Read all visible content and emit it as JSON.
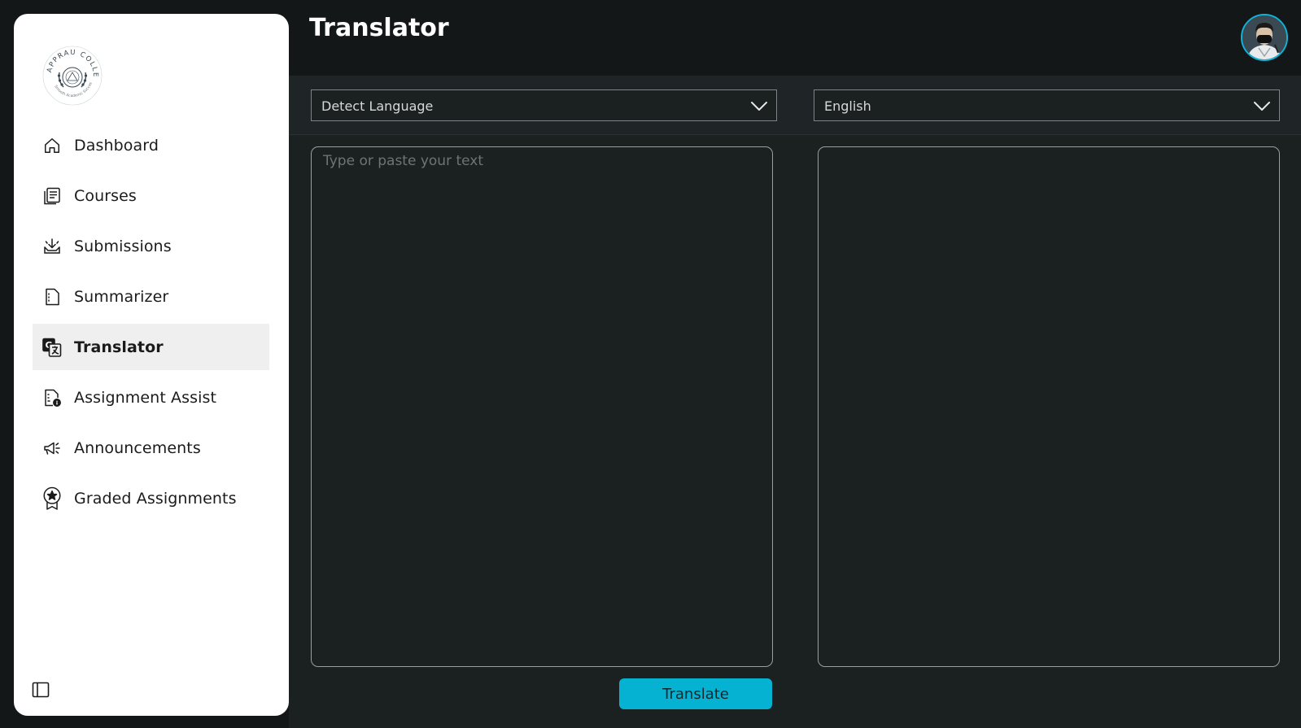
{
  "page": {
    "title": "Translator"
  },
  "sidebar": {
    "logo": {
      "name": "APPRAU COLLEGE",
      "motto": "Smooth Academic Success"
    },
    "items": [
      {
        "label": "Dashboard",
        "icon": "home-icon",
        "active": false
      },
      {
        "label": "Courses",
        "icon": "courses-icon",
        "active": false
      },
      {
        "label": "Submissions",
        "icon": "submissions-icon",
        "active": false
      },
      {
        "label": "Summarizer",
        "icon": "summarizer-icon",
        "active": false
      },
      {
        "label": "Translator",
        "icon": "translate-icon",
        "active": true
      },
      {
        "label": "Assignment Assist",
        "icon": "assignment-assist-icon",
        "active": false
      },
      {
        "label": "Announcements",
        "icon": "megaphone-icon",
        "active": false
      },
      {
        "label": "Graded Assignments",
        "icon": "award-icon",
        "active": false
      }
    ],
    "collapse_icon": "sidebar-toggle-icon"
  },
  "translator": {
    "source_language": "Detect Language",
    "target_language": "English",
    "input_placeholder": "Type or paste your text",
    "input_value": "",
    "output_value": "",
    "translate_label": "Translate"
  },
  "colors": {
    "accent": "#06b2d2",
    "background": "#131718",
    "panel": "#1b2021",
    "sidebar": "#ffffff",
    "active_item": "#efefef"
  }
}
